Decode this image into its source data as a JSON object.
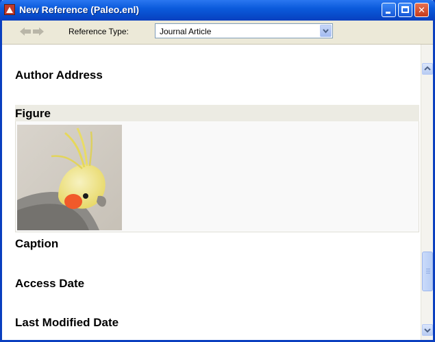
{
  "window": {
    "title": "New Reference (Paleo.enl)"
  },
  "toolbar": {
    "reference_type_label": "Reference Type:",
    "reference_type_value": "Journal Article"
  },
  "fields": {
    "author_address": "Author Address",
    "figure": "Figure",
    "caption": "Caption",
    "access_date": "Access Date",
    "last_modified_date": "Last Modified Date"
  },
  "icons": [
    "app-icon",
    "back-arrow-icon",
    "forward-arrow-icon",
    "chevron-down-icon",
    "minimize-icon",
    "maximize-icon",
    "close-icon",
    "scroll-up-icon",
    "scroll-down-icon"
  ],
  "colors": {
    "titlebar": "#0b5bdc",
    "close_button": "#c43b1d",
    "figure_band": "#ecebe3"
  }
}
